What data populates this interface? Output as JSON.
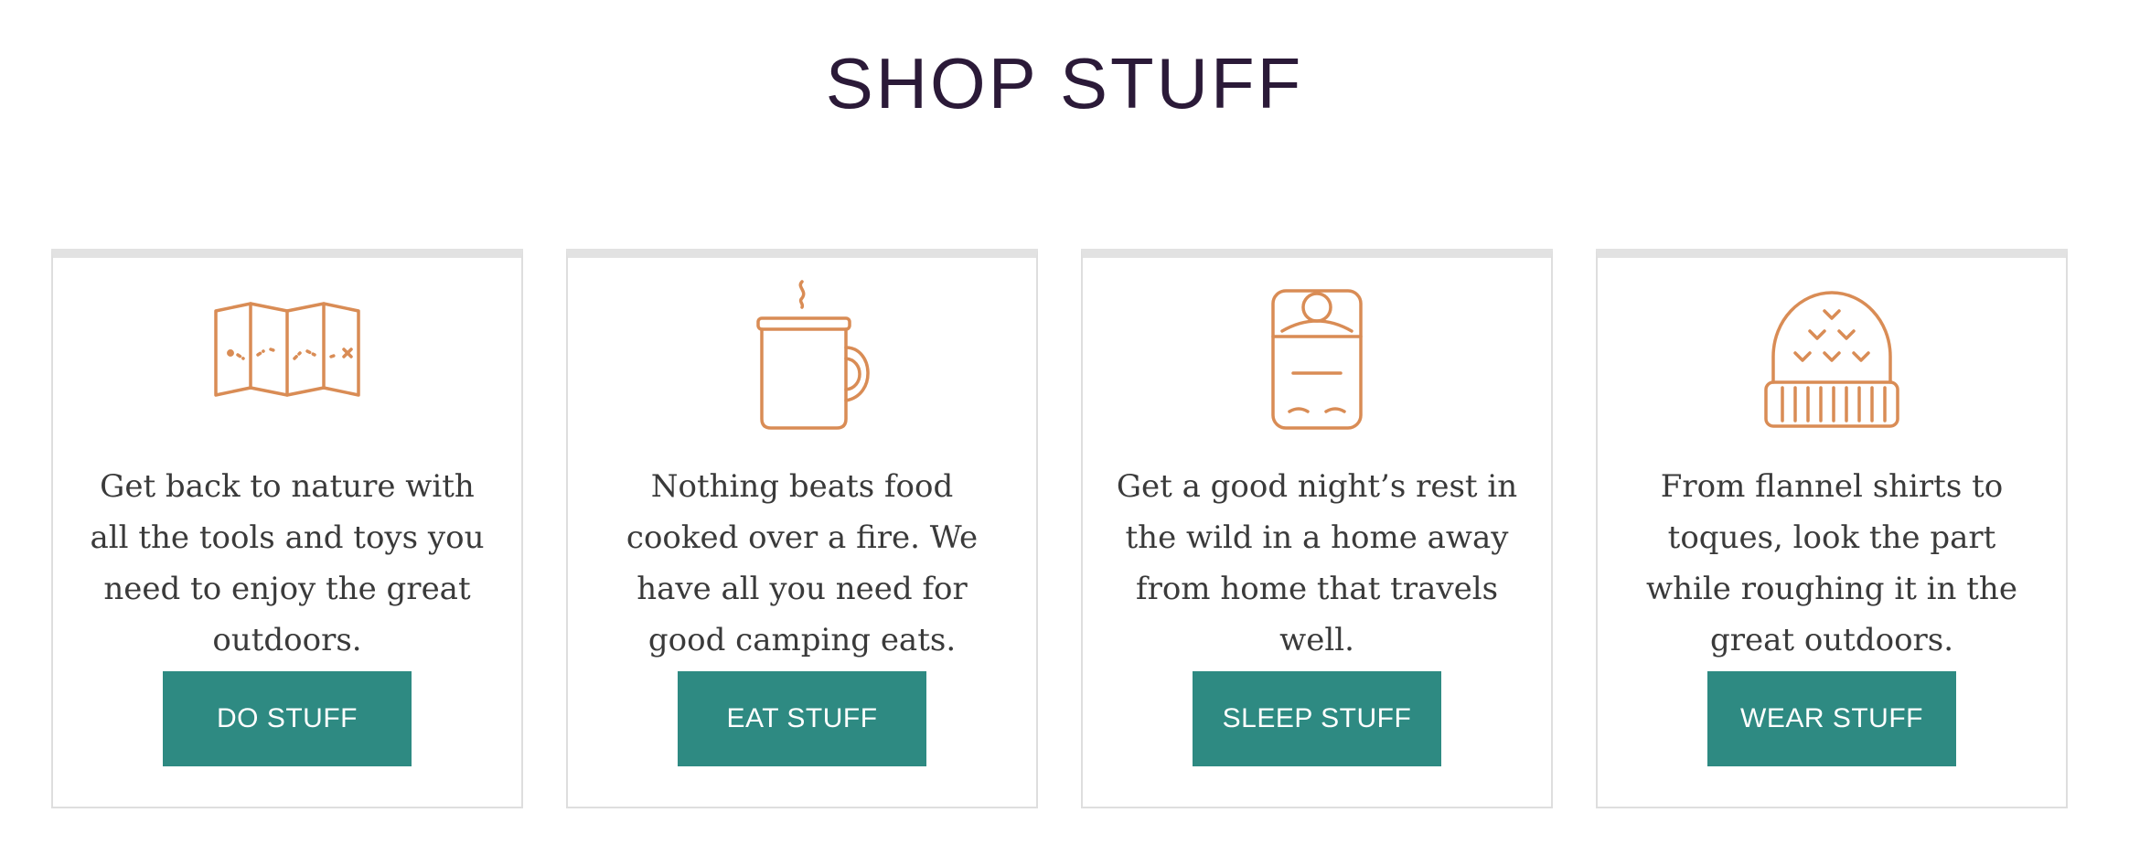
{
  "header": {
    "title": "SHOP STUFF"
  },
  "colors": {
    "title": "#2b1a38",
    "accent": "#d98c55",
    "button": "#2e8a82",
    "card_border": "#dedede",
    "text": "#3a3a3a"
  },
  "cards": [
    {
      "icon": "map-icon",
      "description": "Get back to nature with all the tools and toys you need to enjoy the great outdoors.",
      "button_label": "DO STUFF"
    },
    {
      "icon": "mug-icon",
      "description": "Nothing beats food cooked over a fire. We have all you need for good camping eats.",
      "button_label": "EAT STUFF"
    },
    {
      "icon": "sleeping-bag-icon",
      "description": "Get a good night’s rest in the wild in a home away from home that travels well.",
      "button_label": "SLEEP STUFF"
    },
    {
      "icon": "toque-icon",
      "description": "From flannel shirts to toques, look the part while roughing it in the great outdoors.",
      "button_label": "WEAR STUFF"
    }
  ]
}
